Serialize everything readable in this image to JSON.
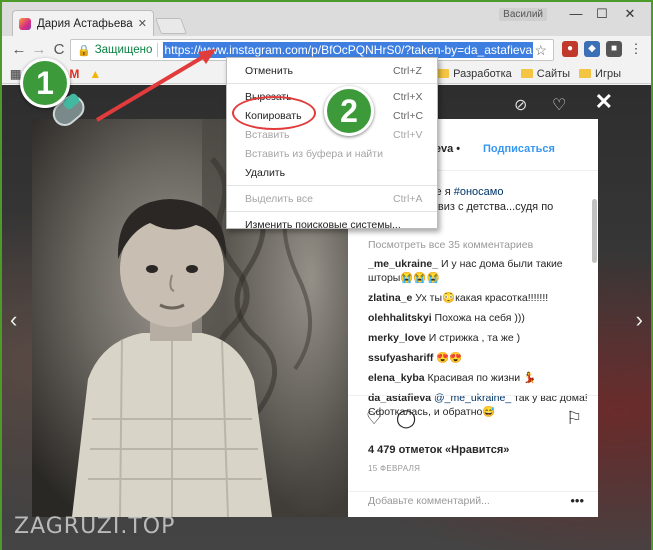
{
  "browser": {
    "tab_title": "Дария Астафьева (@da_",
    "tab_close": "✕",
    "user_name": "Василий",
    "window_buttons": [
      "—",
      "☐",
      "✕"
    ],
    "security_label": "Защищено",
    "url": "https://www.instagram.com/p/BfOcPQNHrS0/?taken-by=da_astafieva",
    "back_icon": "←",
    "forward_icon": "→",
    "reload_icon": "C",
    "star_icon": "☆"
  },
  "bookmarks": [
    {
      "label": "Разработка",
      "type": "folder"
    },
    {
      "label": "Сайты",
      "type": "folder"
    },
    {
      "label": "Игры",
      "type": "folder"
    }
  ],
  "instagram": {
    "username": "afieva",
    "follow": "Подписаться",
    "caption_prefix": "это не я ",
    "caption_tag": "#оносамо",
    "caption_rest": "ой девиз с детства...судя по",
    "view_all_comments": "Посмотреть все 35 комментариев",
    "comments": [
      {
        "user": "_me_ukraine_",
        "text": "И у нас дома были такие шторы😭😭😭"
      },
      {
        "user": "zlatina_e",
        "text": "Ух ты😳какая красотка!!!!!!!"
      },
      {
        "user": "olehhalitskyi",
        "text": "Похожа на себя )))"
      },
      {
        "user": "merky_love",
        "text": "И стрижка , та же )"
      },
      {
        "user": "ssufyashariff",
        "text": "😍😍"
      },
      {
        "user": "elena_kyba",
        "text": "Красивая по жизни 💃"
      },
      {
        "user": "da_astafieva",
        "mention": "@_me_ukraine_",
        "text": "так у вас дома! Сфоткалась, и обратно😅"
      }
    ],
    "likes": "4 479 отметок «Нравится»",
    "date": "15 ФЕВРАЛЯ",
    "add_comment_placeholder": "Добавьте комментарий...",
    "more_icon": "•••",
    "close_icon": "✕"
  },
  "context_menu": [
    {
      "label": "Отменить",
      "shortcut": "Ctrl+Z",
      "enabled": true
    },
    {
      "separator": true
    },
    {
      "label": "Вырезать",
      "shortcut": "Ctrl+X",
      "enabled": true
    },
    {
      "label": "Копировать",
      "shortcut": "Ctrl+C",
      "enabled": true
    },
    {
      "label": "Вставить",
      "shortcut": "Ctrl+V",
      "enabled": false
    },
    {
      "label": "Вставить из буфера и найти",
      "shortcut": "",
      "enabled": false
    },
    {
      "label": "Удалить",
      "shortcut": "",
      "enabled": true
    },
    {
      "separator": true
    },
    {
      "label": "Выделить все",
      "shortcut": "Ctrl+A",
      "enabled": false
    },
    {
      "separator": true
    },
    {
      "label": "Изменить поисковые системы...",
      "shortcut": "",
      "enabled": true
    }
  ],
  "annotations": {
    "step1": "1",
    "step2": "2",
    "accent_green": "#3c9a3a",
    "highlight_red": "#e23b3b"
  },
  "watermark": "ZAGRUZI.TOP"
}
